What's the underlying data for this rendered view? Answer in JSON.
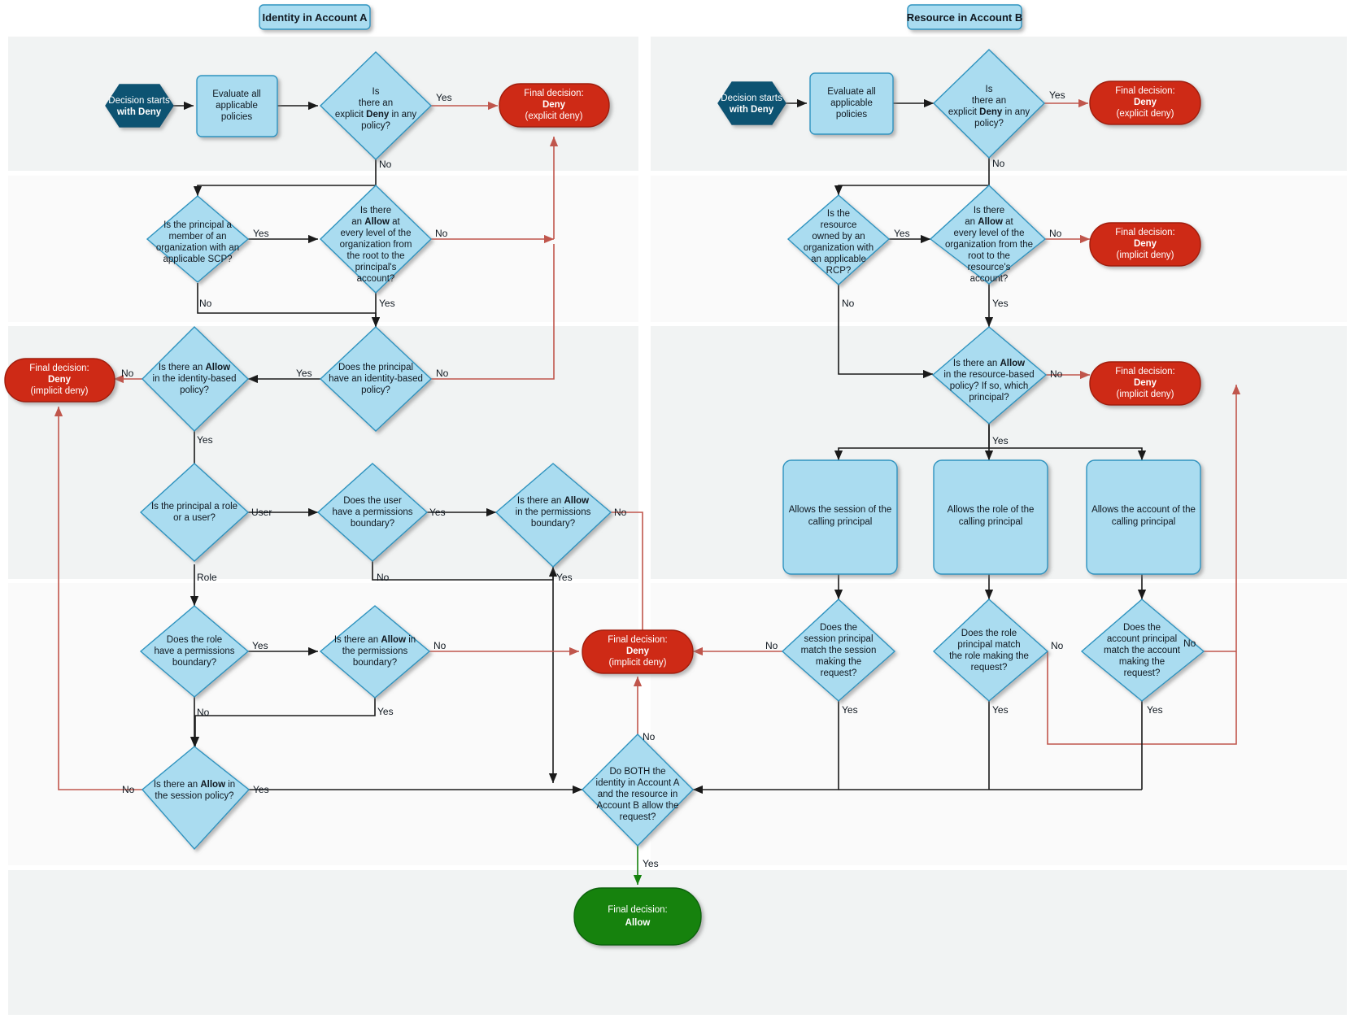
{
  "colors": {
    "lane_dark": "#f1f3f3",
    "lane_light": "#fafafa",
    "node_fill": "#aadcf0",
    "node_stroke": "#2f93bf",
    "start_fill": "#0d5272",
    "start_stroke": "#0d5272",
    "deny_fill": "#ce2a12",
    "deny_stroke": "#a01f0c",
    "allow_fill": "#15820d",
    "allow_stroke": "#0f6409",
    "edge_black": "#1a1a1a",
    "edge_red": "#c0564c",
    "edge_green": "#15820d",
    "header_fill": "#aadcf0",
    "header_stroke": "#2f93bf"
  },
  "pools": [
    {
      "id": "pool-a",
      "title": "Identity in Account A"
    },
    {
      "id": "pool-b",
      "title": "Resource in Account B"
    }
  ],
  "edge_labels": {
    "yes": "Yes",
    "no": "No",
    "user": "User",
    "role": "Role"
  },
  "nodes": {
    "a_start": {
      "text": "Decision starts\nwith **Deny**",
      "shape": "hexagon"
    },
    "a_evaluate": {
      "text": "Evaluate all\napplicable\npolicies",
      "shape": "box"
    },
    "a_explicit": {
      "text": "Is\nthere an\nexplicit **Deny** in any\npolicy?",
      "shape": "diamond"
    },
    "a_deny_explicit": {
      "text": "Final decision:\n**Deny**\n(explicit deny)",
      "shape": "terminator"
    },
    "a_scp": {
      "text": "Is the principal a\nmember of an\norganization with an\napplicable SCP?",
      "shape": "diamond"
    },
    "a_scp_allow": {
      "text": "Is there\nan **Allow** at\nevery level of the\norganization from\nthe root to the\nprincipal's\naccount?",
      "shape": "diamond"
    },
    "a_deny_implicit_1": {
      "text": "Final decision:\n**Deny**\n(implicit deny)",
      "shape": "terminator"
    },
    "a_has_identity": {
      "text": "Does the principal\nhave an identity-based\npolicy?",
      "shape": "diamond"
    },
    "a_identity_allow": {
      "text": "Is there an **Allow**\nin the identity-based\npolicy?",
      "shape": "diamond"
    },
    "a_role_or_user": {
      "text": "Is the principal a role\nor a user?",
      "shape": "diamond"
    },
    "a_user_pb": {
      "text": "Does the user\nhave a permissions\nboundary?",
      "shape": "diamond"
    },
    "a_user_pb_allow": {
      "text": "Is there an **Allow**\nin the permissions\nboundary?",
      "shape": "diamond"
    },
    "a_role_pb": {
      "text": "Does the role\nhave a permissions\nboundary?",
      "shape": "diamond"
    },
    "a_role_pb_allow": {
      "text": "Is there an **Allow** in\nthe permissions\nboundary?",
      "shape": "diamond"
    },
    "a_session": {
      "text": "Is there an **Allow** in\nthe session policy?",
      "shape": "diamond"
    },
    "a_deny_implicit_2": {
      "text": "Final decision:\n**Deny**\n(implicit deny)",
      "shape": "terminator"
    },
    "b_start": {
      "text": "Decision starts\nwith **Deny**",
      "shape": "hexagon"
    },
    "b_evaluate": {
      "text": "Evaluate all\napplicable\npolicies",
      "shape": "box"
    },
    "b_explicit": {
      "text": "Is\nthere an\nexplicit **Deny** in any\npolicy?",
      "shape": "diamond"
    },
    "b_deny_explicit": {
      "text": "Final decision:\n**Deny**\n(explicit deny)",
      "shape": "terminator"
    },
    "b_rcp": {
      "text": "Is the\nresource\nowned by an\norganization with\nan applicable\nRCP?",
      "shape": "diamond"
    },
    "b_rcp_allow": {
      "text": "Is there\nan **Allow** at\nevery level of the\norganization from the\nroot to the\nresource's\naccount?",
      "shape": "diamond"
    },
    "b_deny_implicit_1": {
      "text": "Final decision:\n**Deny**\n(implicit deny)",
      "shape": "terminator"
    },
    "b_resource_allow": {
      "text": "Is there an **Allow**\nin the resource-based\npolicy? If so, which\nprincipal?",
      "shape": "diamond"
    },
    "b_deny_implicit_2": {
      "text": "Final decision:\n**Deny**\n(implicit deny)",
      "shape": "terminator"
    },
    "b_allows_session": {
      "text": "Allows the session of the\ncalling principal",
      "shape": "box"
    },
    "b_allows_role": {
      "text": "Allows the role of the\ncalling principal",
      "shape": "box"
    },
    "b_allows_account": {
      "text": "Allows the account of the\ncalling principal",
      "shape": "box"
    },
    "b_session_match": {
      "text": "Does the\nsession principal\nmatch the session\nmaking the\nrequest?",
      "shape": "diamond"
    },
    "b_role_match": {
      "text": "Does the role\nprincipal match\nthe role making the\nrequest?",
      "shape": "diamond"
    },
    "b_account_match": {
      "text": "Does the\naccount principal\nmatch the account\nmaking the\nrequest?",
      "shape": "diamond"
    },
    "both": {
      "text": "Do BOTH the\nidentity in Account A\nand the resource in\nAccount B allow the\nrequest?",
      "shape": "diamond"
    },
    "final_allow": {
      "text": "Final decision:\n**Allow**",
      "shape": "terminator"
    }
  }
}
